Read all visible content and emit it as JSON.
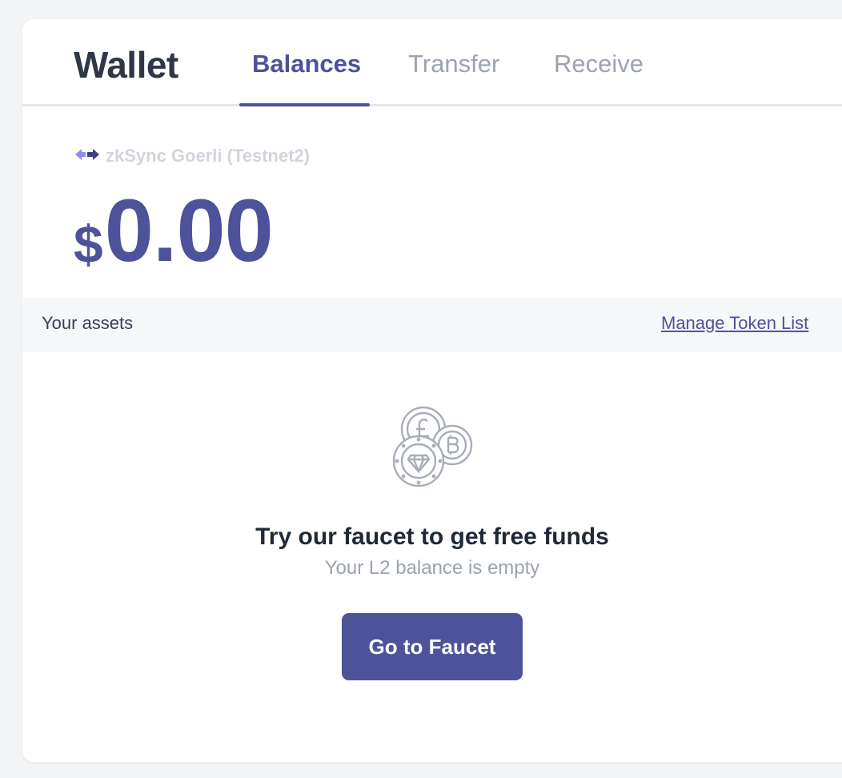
{
  "header": {
    "title": "Wallet",
    "tabs": [
      {
        "label": "Balances",
        "active": true
      },
      {
        "label": "Transfer",
        "active": false
      },
      {
        "label": "Receive",
        "active": false
      }
    ]
  },
  "network": {
    "icon": "arrows-exchange-icon",
    "label": "zkSync Goerli (Testnet2)"
  },
  "balance": {
    "currency_symbol": "$",
    "amount": "0.00"
  },
  "assets": {
    "label": "Your assets",
    "manage_link": "Manage Token List"
  },
  "empty_state": {
    "icon": "coins-icon",
    "title": "Try our faucet to get free funds",
    "subtitle": "Your L2 balance is empty",
    "button_label": "Go to Faucet"
  },
  "colors": {
    "accent": "#4e529a",
    "background": "#f3f4f6",
    "title": "#2d3748",
    "muted": "#9ca3af"
  }
}
